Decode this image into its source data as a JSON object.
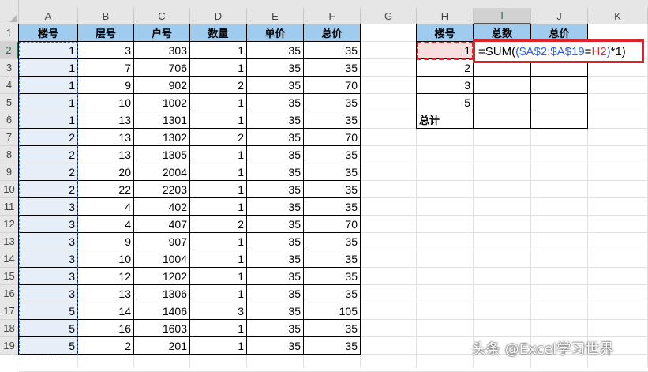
{
  "columns": [
    "A",
    "B",
    "C",
    "D",
    "E",
    "F",
    "G",
    "H",
    "I",
    "J",
    "K"
  ],
  "rows": [
    "1",
    "2",
    "3",
    "4",
    "5",
    "6",
    "7",
    "8",
    "9",
    "10",
    "11",
    "12",
    "13",
    "14",
    "15",
    "16",
    "17",
    "18",
    "19"
  ],
  "left_table": {
    "headers": [
      "楼号",
      "层号",
      "户号",
      "数量",
      "单价",
      "总价"
    ],
    "data": [
      [
        "1",
        "3",
        "303",
        "1",
        "35",
        "35"
      ],
      [
        "1",
        "7",
        "706",
        "1",
        "35",
        "35"
      ],
      [
        "1",
        "9",
        "902",
        "2",
        "35",
        "70"
      ],
      [
        "1",
        "10",
        "1002",
        "1",
        "35",
        "35"
      ],
      [
        "1",
        "13",
        "1301",
        "1",
        "35",
        "35"
      ],
      [
        "2",
        "13",
        "1302",
        "2",
        "35",
        "70"
      ],
      [
        "2",
        "13",
        "1305",
        "1",
        "35",
        "35"
      ],
      [
        "2",
        "20",
        "2004",
        "1",
        "35",
        "35"
      ],
      [
        "2",
        "22",
        "2203",
        "1",
        "35",
        "35"
      ],
      [
        "3",
        "4",
        "402",
        "1",
        "35",
        "35"
      ],
      [
        "3",
        "4",
        "407",
        "2",
        "35",
        "70"
      ],
      [
        "3",
        "9",
        "907",
        "1",
        "35",
        "35"
      ],
      [
        "3",
        "10",
        "1004",
        "1",
        "35",
        "35"
      ],
      [
        "3",
        "12",
        "1202",
        "1",
        "35",
        "35"
      ],
      [
        "3",
        "13",
        "1306",
        "1",
        "35",
        "35"
      ],
      [
        "5",
        "14",
        "1406",
        "3",
        "35",
        "105"
      ],
      [
        "5",
        "16",
        "1603",
        "1",
        "35",
        "35"
      ],
      [
        "5",
        "2",
        "201",
        "1",
        "35",
        "35"
      ]
    ]
  },
  "right_table": {
    "headers": [
      "楼号",
      "总数",
      "总价"
    ],
    "keys": [
      "1",
      "2",
      "3",
      "5"
    ],
    "total_label": "总计"
  },
  "formula": {
    "part1": "=SUM(",
    "part2": "(",
    "part3": "$A$2:$A$19",
    "part4": "=",
    "part5": "H2",
    "part6": ")",
    "part7": "*1)"
  },
  "selected_cell": "I2",
  "watermark": "头条 @Excel学习世界",
  "colors": {
    "header_fill": "#9fcbef",
    "formula_border": "#e0232b",
    "selection": "#217346"
  }
}
